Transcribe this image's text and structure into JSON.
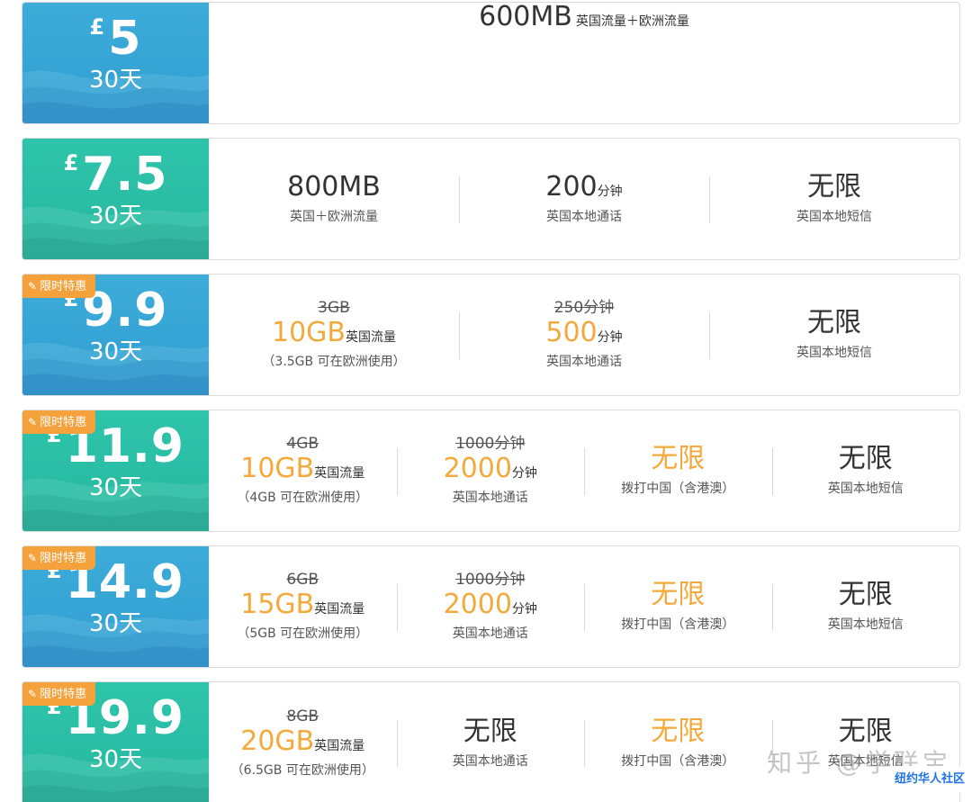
{
  "plans": [
    {
      "currency": "£",
      "price": "5",
      "days": "30天",
      "badge": "",
      "cells": [
        {
          "main": "600MB",
          "unit": "英国流量＋欧洲流量"
        }
      ]
    },
    {
      "currency": "£",
      "price": "7.5",
      "days": "30天",
      "badge": "",
      "cells": [
        {
          "main": "800MB",
          "sub": "英国＋欧洲流量"
        },
        {
          "main": "200",
          "unit": "分钟",
          "sub": "英国本地通话"
        },
        {
          "main": "无限",
          "sub": "英国本地短信"
        }
      ]
    },
    {
      "currency": "£",
      "price": "9.9",
      "days": "30天",
      "badge": "限时特惠",
      "cells": [
        {
          "old": "3GB",
          "main": "10GB",
          "unit": "英国流量",
          "sub": "（3.5GB 可在欧洲使用）"
        },
        {
          "old": "250分钟",
          "main": "500",
          "unit": "分钟",
          "sub": "英国本地通话"
        },
        {
          "main": "无限",
          "sub": "英国本地短信"
        }
      ]
    },
    {
      "currency": "£",
      "price": "11.9",
      "days": "30天",
      "badge": "限时特惠",
      "cells": [
        {
          "old": "4GB",
          "main": "10GB",
          "unit": "英国流量",
          "sub": "（4GB 可在欧洲使用）"
        },
        {
          "old": "1000分钟",
          "main": "2000",
          "unit": "分钟",
          "sub": "英国本地通话"
        },
        {
          "main": "无限",
          "sub": "拨打中国（含港澳）"
        },
        {
          "main": "无限",
          "sub": "英国本地短信"
        }
      ]
    },
    {
      "currency": "£",
      "price": "14.9",
      "days": "30天",
      "badge": "限时特惠",
      "cells": [
        {
          "old": "6GB",
          "main": "15GB",
          "unit": "英国流量",
          "sub": "（5GB 可在欧洲使用）"
        },
        {
          "old": "1000分钟",
          "main": "2000",
          "unit": "分钟",
          "sub": "英国本地通话"
        },
        {
          "main": "无限",
          "sub": "拨打中国（含港澳）"
        },
        {
          "main": "无限",
          "sub": "英国本地短信"
        }
      ]
    },
    {
      "currency": "£",
      "price": "19.9",
      "days": "30天",
      "badge": "限时特惠",
      "cells": [
        {
          "old": "8GB",
          "main": "20GB",
          "unit": "英国流量",
          "sub": "（6.5GB 可在欧洲使用）"
        },
        {
          "main": "无限",
          "sub": "英国本地通话"
        },
        {
          "main": "无限",
          "sub": "拨打中国（含港澳）"
        },
        {
          "main": "无限",
          "sub": "英国本地短信"
        }
      ]
    }
  ],
  "watermark": {
    "text": "知乎 @学联宝",
    "tag": "纽约华人社区"
  },
  "colors": {
    "blue": "#3dacd9",
    "teal": "#2ec4aa",
    "orange": "#f3a93b",
    "badge": "#f5a23c"
  }
}
